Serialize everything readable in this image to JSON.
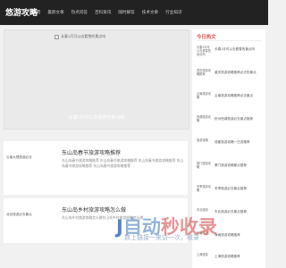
{
  "site": {
    "logo": "悠游攻略"
  },
  "nav": [
    {
      "label": "首页"
    },
    {
      "label": "最新文章"
    },
    {
      "label": "热点问答"
    },
    {
      "label": "百科资讯"
    },
    {
      "label": "随时解答"
    },
    {
      "label": "技术文章"
    },
    {
      "label": "行业知识"
    }
  ],
  "hero": {
    "broken_alt": "长春1月可以去看雪的景点吗",
    "caption": "长春1月可以去看雪的景点吗"
  },
  "posts": [
    {
      "thumb_alt": "云南大理旅游必去",
      "title": "东山岛春节旅游攻略推荐",
      "desc": "东山岛春节旅游攻略推荐 东山岛春节旅游攻略推荐 东山岛春节旅游攻略推荐 东山岛春节旅游攻略推荐 东山岛春节旅游攻略推荐"
    },
    {
      "thumb_alt": "北京旅游必去景点",
      "title": "东山岛乡村旅游攻略怎么做",
      "desc": "东山岛乡村旅游攻略怎么做东山岛乡村旅游攻略怎么做"
    }
  ],
  "sidebar": {
    "title": "今日热文",
    "items": [
      {
        "thumb": "长春1月可以去看雪的景点吗",
        "text": "长春1月可以去看雪的景点吗"
      },
      {
        "thumb": "重庆旅游攻略推荐",
        "text": "重庆旅游攻略推荐必去的景点"
      },
      {
        "thumb": "云南旅游攻略",
        "text": "云南旅游攻略推荐必去景点"
      },
      {
        "thumb": "西湖旅游攻略",
        "text": "杭州西湖旅游必去景点推荐"
      },
      {
        "thumb": "旅游攻略",
        "text": "成都旅游攻略一日游推荐"
      },
      {
        "thumb": "厦门旅游攻略",
        "text": "厦门旅游攻略景点推荐"
      },
      {
        "thumb": "冬季旅游攻略",
        "text": "冬季旅游必去景点推荐"
      },
      {
        "thumb": "东北旅游",
        "text": "东北旅游必去景点推荐"
      },
      {
        "thumb": "海南旅游",
        "text": "海南旅游攻略推荐"
      },
      {
        "thumb": "上海旅游",
        "text": "上海旅游攻略推荐"
      }
    ]
  },
  "watermark": {
    "logo_j": "J",
    "logo_rest": "自动",
    "logo_c": "秒收录",
    "tagline": "数上链接一来访一次，收录"
  }
}
